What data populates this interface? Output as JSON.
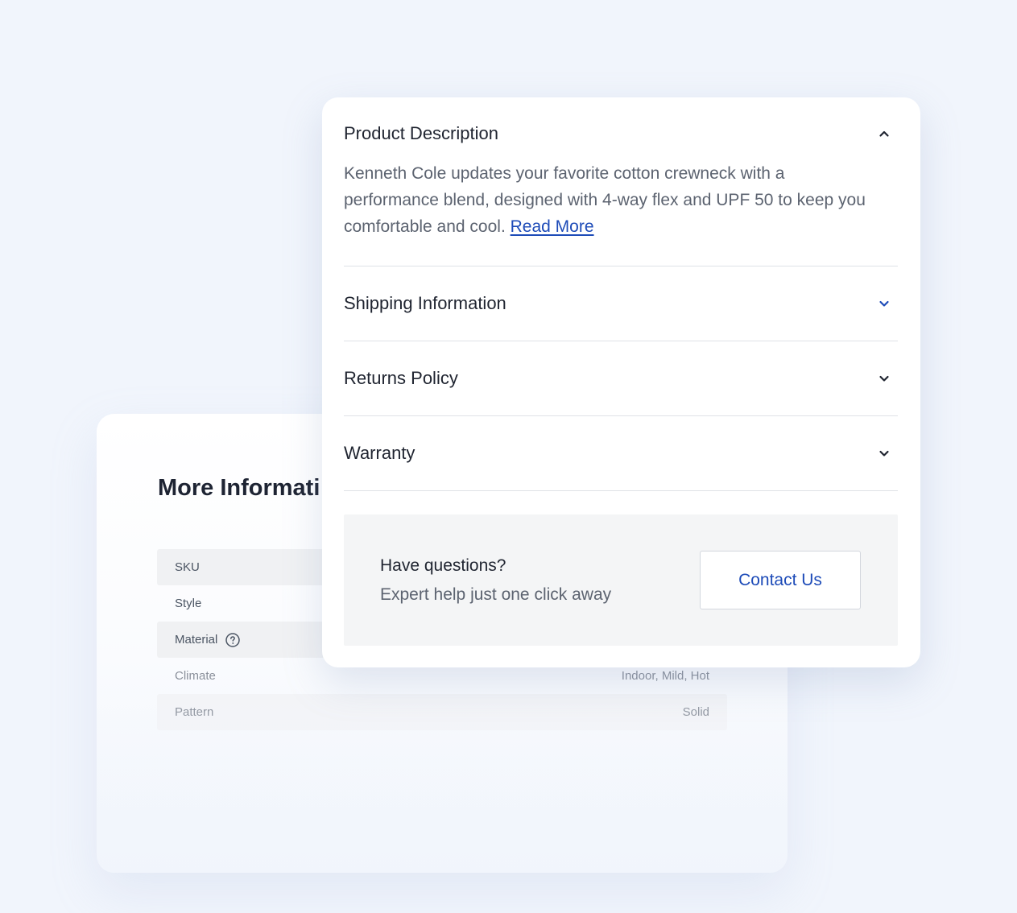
{
  "more_info": {
    "title": "More Informati",
    "rows": [
      {
        "label": "SKU",
        "value": "",
        "shaded": true,
        "help": false
      },
      {
        "label": "Style",
        "value": "",
        "shaded": false,
        "help": false
      },
      {
        "label": "Material",
        "value": "",
        "shaded": true,
        "help": true
      },
      {
        "label": "Climate",
        "value": "Indoor, Mild, Hot",
        "shaded": false,
        "help": false
      },
      {
        "label": "Pattern",
        "value": "Solid",
        "shaded": true,
        "help": false
      }
    ]
  },
  "accordion": {
    "product_description": {
      "title": "Product Description",
      "body": "Kenneth Cole updates your favorite cotton crewneck with a performance blend, designed with 4-way flex and UPF 50 to keep you comfortable and cool.",
      "read_more": "Read More",
      "expanded": true,
      "icon": "chevron-up-icon"
    },
    "shipping": {
      "title": "Shipping Information",
      "expanded": false,
      "icon": "chevron-down-icon",
      "icon_color": "#1d4bb8"
    },
    "returns": {
      "title": "Returns Policy",
      "expanded": false,
      "icon": "chevron-down-icon"
    },
    "warranty": {
      "title": "Warranty",
      "expanded": false,
      "icon": "chevron-down-icon"
    }
  },
  "help": {
    "question": "Have questions?",
    "subtitle": "Expert help just one click away",
    "contact_label": "Contact Us"
  },
  "colors": {
    "background": "#f1f5fc",
    "accent_link": "#1d4bb8",
    "text_primary": "#1f2430",
    "text_secondary": "#5c6370"
  }
}
